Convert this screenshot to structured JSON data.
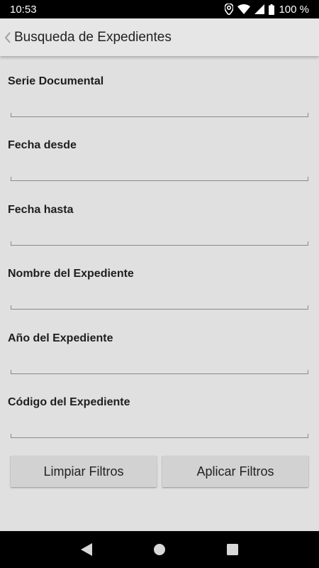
{
  "status_bar": {
    "time": "10:53",
    "battery": "100 %",
    "icons": [
      "location-icon",
      "wifi-icon",
      "signal-icon",
      "battery-icon"
    ]
  },
  "app_bar": {
    "title": "Busqueda de Expedientes",
    "back_icon": "chevron-left-icon"
  },
  "form": {
    "fields": [
      {
        "label": "Serie Documental",
        "value": ""
      },
      {
        "label": "Fecha desde",
        "value": ""
      },
      {
        "label": "Fecha hasta",
        "value": ""
      },
      {
        "label": "Nombre del Expediente",
        "value": ""
      },
      {
        "label": "Año del Expediente",
        "value": ""
      },
      {
        "label": "Código del Expediente",
        "value": ""
      }
    ],
    "buttons": {
      "clear_label": "Limpiar Filtros",
      "apply_label": "Aplicar Filtros"
    }
  },
  "nav_bar": {
    "icons": [
      "back-triangle-icon",
      "home-circle-icon",
      "recents-square-icon"
    ]
  },
  "colors": {
    "status_bar_bg": "#000000",
    "app_bar_bg": "#e6e6e6",
    "page_bg": "#e0e0e0",
    "button_bg": "#d2d2d2"
  }
}
